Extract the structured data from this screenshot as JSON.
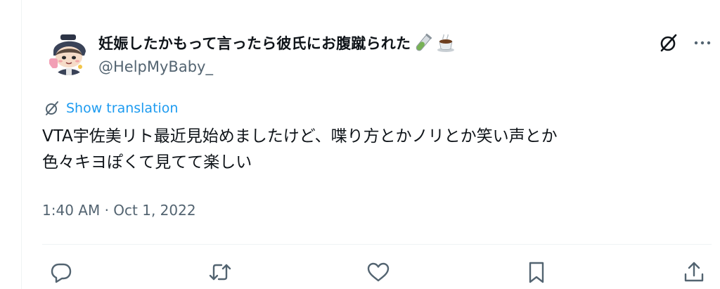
{
  "author": {
    "display_name": "妊娠したかもって言ったら彼氏にお腹蹴られた",
    "handle": "@HelpMyBaby_",
    "name_emojis": [
      "test-tube-icon",
      "coffee-cup-icon"
    ]
  },
  "tweet": {
    "translate_label": "Show translation",
    "text_line_1": "VTA宇佐美リト最近見始めましたけど、喋り方とかノリとか笑い声とか",
    "text_line_2": "色々キヨぽくて見てて楽しい",
    "timestamp": "1:40 AM · Oct 1, 2022"
  },
  "actions": [
    "reply-icon",
    "retweet-icon",
    "like-icon",
    "bookmark-icon",
    "share-icon"
  ],
  "colors": {
    "link": "#1d9bf0",
    "secondary_text": "#536471",
    "primary_text": "#0f1419",
    "divider": "#eff3f4"
  }
}
